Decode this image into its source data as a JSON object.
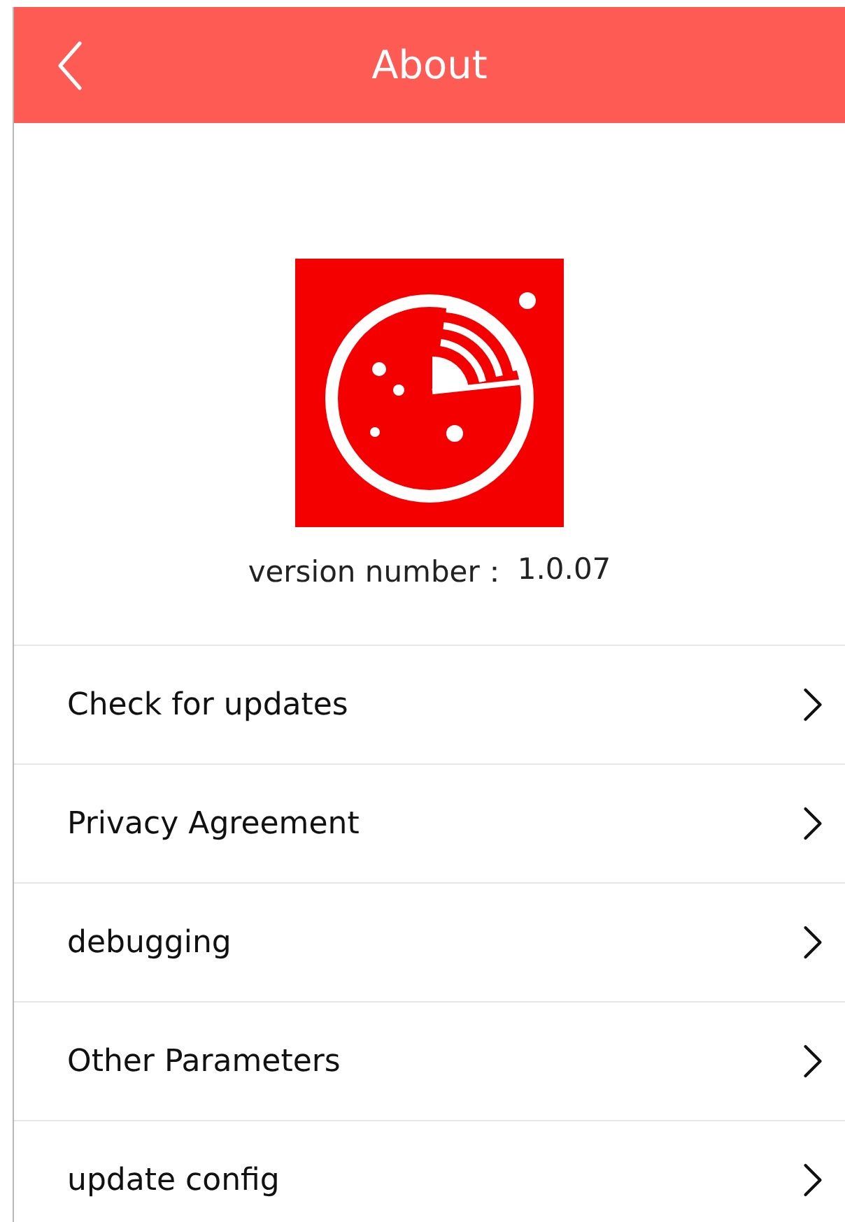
{
  "header": {
    "title": "About"
  },
  "app": {
    "version_label": "version number：",
    "version_value": "1.0.07"
  },
  "menu": [
    {
      "label": "Check for updates"
    },
    {
      "label": "Privacy Agreement"
    },
    {
      "label": "debugging"
    },
    {
      "label": "Other Parameters"
    },
    {
      "label": "update config"
    }
  ]
}
